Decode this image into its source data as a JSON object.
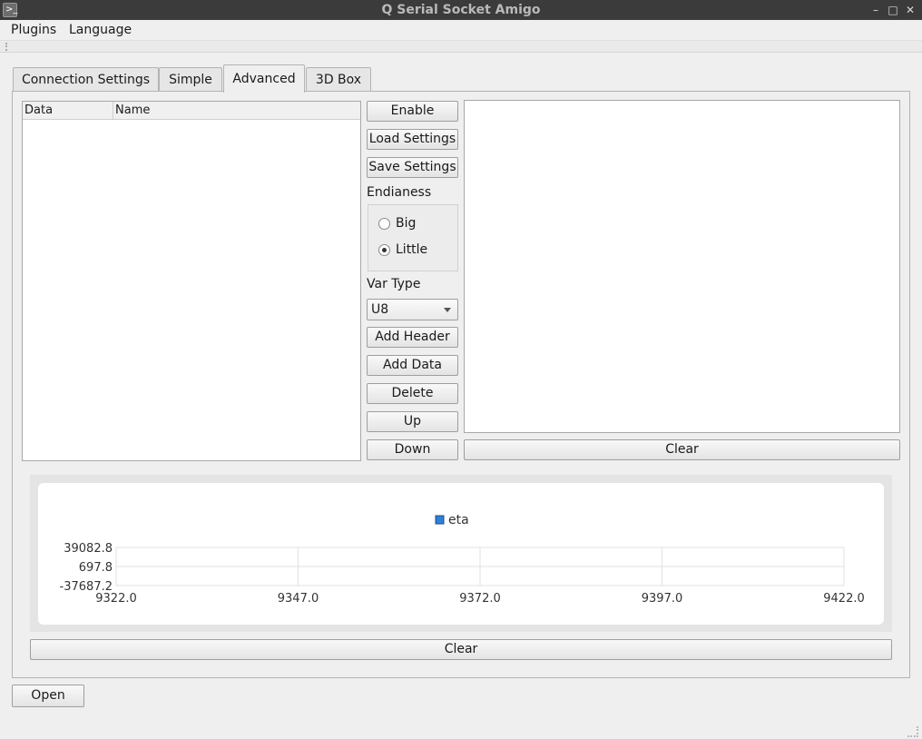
{
  "window": {
    "title": "Q Serial Socket Amigo",
    "buttons": {
      "minimize": "–",
      "maximize": "□",
      "close": "✕"
    }
  },
  "menu": {
    "items": [
      "Plugins",
      "Language"
    ]
  },
  "tabs": [
    "Connection Settings",
    "Simple",
    "Advanced",
    "3D Box"
  ],
  "active_tab": "Advanced",
  "advanced": {
    "list_headers": [
      "Data",
      "Name"
    ],
    "buttons": {
      "enable": "Enable",
      "load": "Load Settings",
      "save": "Save Settings",
      "add_header": "Add Header",
      "add_data": "Add Data",
      "delete": "Delete",
      "up": "Up",
      "down": "Down",
      "clear_text": "Clear"
    },
    "endianess_label": "Endianess",
    "endianess_options": [
      "Big",
      "Little"
    ],
    "endianess_selected": "Little",
    "var_type_label": "Var Type",
    "var_type_value": "U8"
  },
  "chart_data": {
    "type": "line",
    "series": [
      {
        "name": "eta",
        "values": []
      }
    ],
    "x_ticks": [
      "9322.0",
      "9347.0",
      "9372.0",
      "9397.0",
      "9422.0"
    ],
    "y_ticks": [
      "39082.8",
      "697.8",
      "-37687.2"
    ],
    "xlim": [
      9322.0,
      9422.0
    ],
    "ylim": [
      -37687.2,
      39082.8
    ],
    "grid": true,
    "legend_position": "top",
    "series_color": "#2f7ed8"
  },
  "chart_clear_label": "Clear",
  "open_button": "Open"
}
